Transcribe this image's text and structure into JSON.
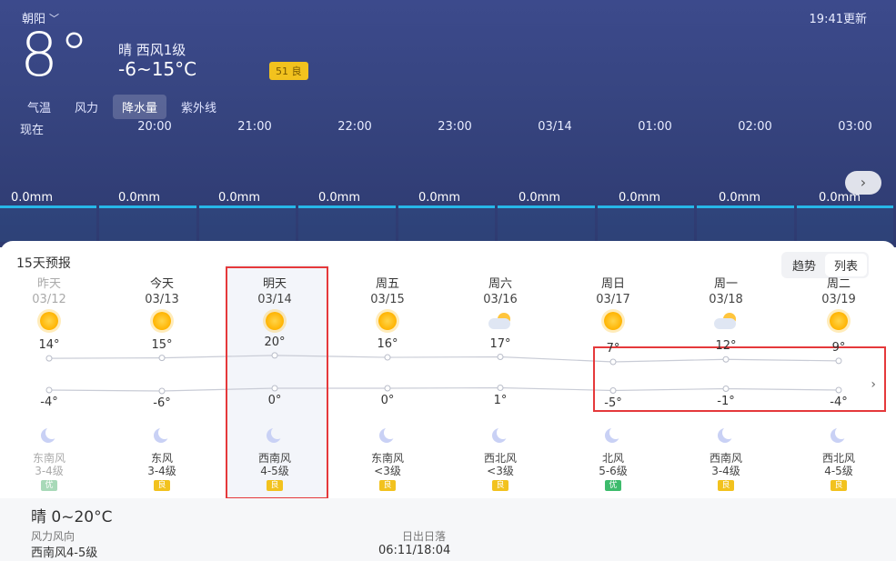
{
  "header": {
    "location": "朝阳",
    "update_time": "19:41更新",
    "current_temp": "8°",
    "condition": "晴 西风1级",
    "temp_range": "-6~15°C",
    "aqi_badge": "51 良",
    "aqi_color": "#f2c21e"
  },
  "hourly_tabs": [
    {
      "label": "气温",
      "active": false
    },
    {
      "label": "风力",
      "active": false
    },
    {
      "label": "降水量",
      "active": true
    },
    {
      "label": "紫外线",
      "active": false
    }
  ],
  "hourly": {
    "times": [
      "现在",
      "20:00",
      "21:00",
      "22:00",
      "23:00",
      "03/14",
      "01:00",
      "02:00",
      "03:00"
    ],
    "precipitation": [
      "0.0mm",
      "0.0mm",
      "0.0mm",
      "0.0mm",
      "0.0mm",
      "0.0mm",
      "0.0mm",
      "0.0mm",
      "0.0mm"
    ],
    "next_icon": "chevron-right-icon"
  },
  "forecast": {
    "title": "15天预报",
    "view_toggle": [
      "趋势",
      "列表"
    ],
    "days": [
      {
        "name": "昨天",
        "date": "03/12",
        "icon": "sun-icon",
        "high": "14°",
        "low": "-4°",
        "high_v": 14,
        "low_v": -4,
        "night_icon": "moon-icon",
        "wind": "东南风",
        "wind_level": "3-4级",
        "aq": "优",
        "past": true
      },
      {
        "name": "今天",
        "date": "03/13",
        "icon": "sun-icon",
        "high": "15°",
        "low": "-6°",
        "high_v": 15,
        "low_v": -6,
        "night_icon": "moon-icon",
        "wind": "东风",
        "wind_level": "3-4级",
        "aq": "良",
        "past": false
      },
      {
        "name": "明天",
        "date": "03/14",
        "icon": "sun-icon",
        "high": "20°",
        "low": "0°",
        "high_v": 20,
        "low_v": 0,
        "night_icon": "moon-icon",
        "wind": "西南风",
        "wind_level": "4-5级",
        "aq": "良",
        "past": false
      },
      {
        "name": "周五",
        "date": "03/15",
        "icon": "sun-icon",
        "high": "16°",
        "low": "0°",
        "high_v": 16,
        "low_v": 0,
        "night_icon": "moon-icon",
        "wind": "东南风",
        "wind_level": "<3级",
        "aq": "良",
        "past": false
      },
      {
        "name": "周六",
        "date": "03/16",
        "icon": "partly-cloudy-icon",
        "high": "17°",
        "low": "1°",
        "high_v": 17,
        "low_v": 1,
        "night_icon": "moon-icon",
        "wind": "西北风",
        "wind_level": "<3级",
        "aq": "良",
        "past": false
      },
      {
        "name": "周日",
        "date": "03/17",
        "icon": "sun-icon",
        "high": "7°",
        "low": "-5°",
        "high_v": 7,
        "low_v": -5,
        "night_icon": "moon-icon",
        "wind": "北风",
        "wind_level": "5-6级",
        "aq": "优",
        "past": false
      },
      {
        "name": "周一",
        "date": "03/18",
        "icon": "partly-cloudy-icon",
        "high": "12°",
        "low": "-1°",
        "high_v": 12,
        "low_v": -1,
        "night_icon": "moon-icon",
        "wind": "西南风",
        "wind_level": "3-4级",
        "aq": "良",
        "past": false
      },
      {
        "name": "周二",
        "date": "03/19",
        "icon": "sun-icon",
        "high": "9°",
        "low": "-4°",
        "high_v": 9,
        "low_v": -4,
        "night_icon": "moon-icon",
        "wind": "西北风",
        "wind_level": "4-5级",
        "aq": "良",
        "past": false
      }
    ]
  },
  "detail": {
    "title": "晴 0~20°C",
    "wind_label": "风力风向",
    "wind_value": "西南风4-5级",
    "sun_label": "日出日落",
    "sun_value": "06:11/18:04"
  },
  "colors": {
    "header_bg": "#36447f",
    "precip_bar": "#27b7e8",
    "highlight_box": "#e5393b",
    "aq_good": "#3dbb6c",
    "aq_moderate": "#f2c21e"
  }
}
